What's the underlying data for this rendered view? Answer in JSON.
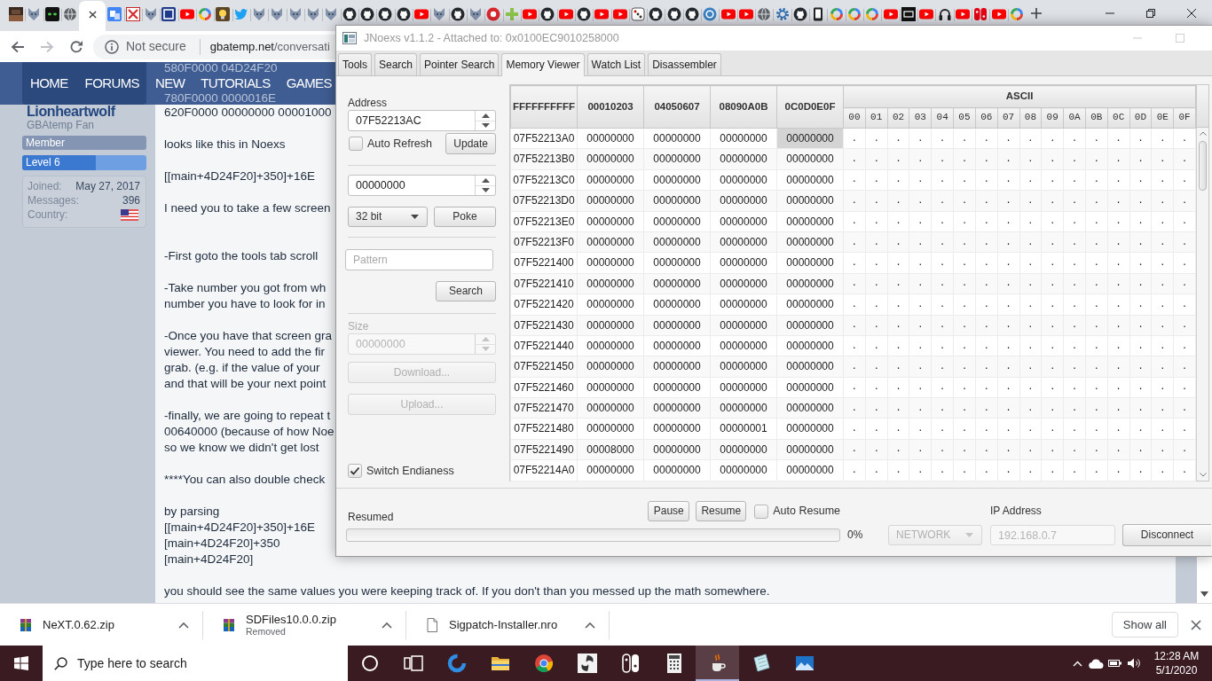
{
  "browser": {
    "tabs": [
      {
        "kind": "photo",
        "selected": false
      },
      {
        "kind": "wolf",
        "selected": false
      },
      {
        "kind": "eyes",
        "selected": false
      },
      {
        "kind": "globe",
        "selected": false
      },
      {
        "selected": true
      },
      {
        "kind": "translate",
        "selected": false
      },
      {
        "kind": "cross",
        "selected": false
      },
      {
        "kind": "wolf",
        "selected": false
      },
      {
        "kind": "square",
        "selected": false
      },
      {
        "kind": "play",
        "selected": false
      },
      {
        "kind": "ring",
        "selected": false
      },
      {
        "kind": "bulb",
        "selected": false
      },
      {
        "kind": "bird",
        "selected": false
      },
      {
        "kind": "wolf",
        "selected": false
      },
      {
        "kind": "wolf",
        "selected": false
      },
      {
        "kind": "wolf",
        "selected": false
      },
      {
        "kind": "wolf",
        "selected": false
      },
      {
        "kind": "wolf",
        "selected": false
      },
      {
        "kind": "cat",
        "selected": false
      },
      {
        "kind": "cat",
        "selected": false
      },
      {
        "kind": "cat",
        "selected": false
      },
      {
        "kind": "cat",
        "selected": false
      },
      {
        "kind": "play",
        "selected": false
      },
      {
        "kind": "wolf",
        "selected": false
      },
      {
        "kind": "cat",
        "selected": false
      },
      {
        "kind": "wolf",
        "selected": false
      },
      {
        "kind": "disc",
        "selected": false
      },
      {
        "kind": "plus",
        "selected": false
      },
      {
        "kind": "play",
        "selected": false
      },
      {
        "kind": "cat",
        "selected": false
      },
      {
        "kind": "play",
        "selected": false
      },
      {
        "kind": "cat",
        "selected": false
      },
      {
        "kind": "play",
        "selected": false
      },
      {
        "kind": "play",
        "selected": false
      },
      {
        "kind": "dice",
        "selected": false
      },
      {
        "kind": "cat",
        "selected": false
      },
      {
        "kind": "cat",
        "selected": false
      },
      {
        "kind": "cat",
        "selected": false
      },
      {
        "kind": "badge",
        "selected": false
      },
      {
        "kind": "play",
        "selected": false
      },
      {
        "kind": "play",
        "selected": false
      },
      {
        "kind": "globe",
        "selected": false
      },
      {
        "kind": "gear",
        "selected": false
      },
      {
        "kind": "cat",
        "selected": false
      },
      {
        "kind": "phone",
        "selected": false
      },
      {
        "kind": "ring",
        "selected": false
      },
      {
        "kind": "ring",
        "selected": false
      },
      {
        "kind": "ring",
        "selected": false
      },
      {
        "kind": "play",
        "selected": false
      },
      {
        "kind": "tile",
        "selected": false
      },
      {
        "kind": "play",
        "selected": false
      },
      {
        "kind": "headphones",
        "selected": false
      },
      {
        "kind": "play",
        "selected": false
      },
      {
        "kind": "controller",
        "selected": false
      },
      {
        "kind": "play",
        "selected": false
      },
      {
        "kind": "ring",
        "selected": false
      }
    ],
    "toolbar": {
      "security": "Not secure",
      "host": "gbatemp.net",
      "path": "/conversati"
    }
  },
  "page": {
    "nav": [
      "HOME",
      "FORUMS",
      "NEW",
      "TUTORIALS",
      "GAMES"
    ],
    "header_lines": [
      "580F0000 04D24F20",
      "780F0000 0000016E"
    ],
    "user": {
      "name": "Lionheartwolf",
      "title": "GBAtemp Fan",
      "badge": "Member",
      "level_label": "Level 6",
      "level": 0.59,
      "stats": [
        {
          "kind": "text",
          "label": "Joined:",
          "value": "May 27, 2017"
        },
        {
          "kind": "text",
          "label": "Messages:",
          "value": "396"
        },
        {
          "kind": "flag",
          "label": "Country:"
        }
      ]
    },
    "post": [
      {
        "kind": "plain",
        "lines": [
          "620F0000 00000000 00001000"
        ]
      },
      {
        "kind": "plain",
        "lines": [
          "looks like this in Noexs"
        ]
      },
      {
        "kind": "plain",
        "lines": [
          "[[main+4D24F20]+350]+16E"
        ]
      },
      {
        "kind": "spaced",
        "lines": [
          "I need you to take a few screen"
        ]
      },
      {
        "kind": "plain",
        "lines": [
          "-First goto the tools tab scroll"
        ]
      },
      {
        "kind": "plain",
        "lines": [
          "-Take number you got from wh",
          "number you have to look for in"
        ]
      },
      {
        "kind": "plain",
        "lines": [
          "-Once you have that screen gra",
          "viewer. You need to add the fir",
          "grab. (e.g. if the value of your",
          "and that will be your next point"
        ]
      },
      {
        "kind": "plain",
        "lines": [
          "-finally, we are going to repeat t",
          "00640000 (because of how Noe",
          "so we know we didn't get lost"
        ]
      },
      {
        "kind": "plain",
        "lines": [
          "****You can also double check"
        ]
      },
      {
        "kind": "plain",
        "lines": [
          "by parsing",
          "[[main+4D24F20]+350]+16E",
          "[main+4D24F20]+350",
          "[main+4D24F20]"
        ]
      },
      {
        "kind": "plain",
        "lines": [
          "you should see the same values you were keeping track of. If you don't than you messed up the math somewhere."
        ]
      }
    ]
  },
  "downloads": {
    "items": [
      {
        "kind": "archive",
        "name": "NeXT.0.62.zip"
      },
      {
        "kind": "archive",
        "name": "SDFiles10.0.0.zip",
        "status": "Removed"
      },
      {
        "kind": "file",
        "name": "Sigpatch-Installer.nro"
      }
    ],
    "show_all": "Show all"
  },
  "taskbar": {
    "search": {
      "placeholder": "Type here to search"
    },
    "apps": [
      {
        "kind": "circle",
        "selected": false
      },
      {
        "kind": "taskview",
        "selected": false
      },
      {
        "kind": "swirlblue",
        "selected": false
      },
      {
        "kind": "folder",
        "selected": false
      },
      {
        "kind": "ball",
        "selected": false
      },
      {
        "kind": "swirl",
        "selected": false
      },
      {
        "kind": "controller",
        "selected": false
      },
      {
        "kind": "calculator",
        "selected": false
      },
      {
        "kind": "cup",
        "selected": true
      },
      {
        "kind": "notepad",
        "selected": false
      },
      {
        "kind": "landscape",
        "selected": false
      }
    ],
    "time": "12:28 AM",
    "date": "5/1/2020"
  },
  "jnoexs": {
    "title": "JNoexs v1.1.2 - Attached to: 0x0100EC9010258000",
    "tabs": [
      {
        "label": "Tools",
        "selected": false
      },
      {
        "label": "Search",
        "selected": false
      },
      {
        "label": "Pointer Search",
        "selected": false
      },
      {
        "label": "Memory Viewer",
        "selected": true
      },
      {
        "label": "Watch List",
        "selected": false
      },
      {
        "label": "Disassembler",
        "selected": false
      }
    ],
    "viewer": {
      "address_label": "Address",
      "address": "07F52213AC",
      "auto_refresh": {
        "label": "Auto Refresh",
        "checked": false
      },
      "update": "Update",
      "poke_value": "00000000",
      "value_type": "32 bit",
      "poke": "Poke",
      "pattern": {
        "placeholder": "Pattern"
      },
      "search": "Search",
      "dump_size": {
        "label": "Size",
        "value": "00000000",
        "disabled": true
      },
      "download": {
        "label": "Download...",
        "disabled": true
      },
      "upload": {
        "label": "Upload...",
        "disabled": true
      },
      "switch_endianess": {
        "label": "Switch Endianess",
        "checked": true
      },
      "table": {
        "columns": [
          "FFFFFFFFFF",
          "00010203",
          "04050607",
          "08090A0B",
          "0C0D0E0F"
        ],
        "ascii_title": "ASCII",
        "ascii_columns": [
          "00",
          "01",
          "02",
          "03",
          "04",
          "05",
          "06",
          "07",
          "08",
          "09",
          "0A",
          "0B",
          "0C",
          "0D",
          "0E",
          "0F"
        ],
        "rows": [
          {
            "address": "07F52213A0",
            "words": [
              {
                "value": "00000000",
                "selected": false
              },
              {
                "value": "00000000",
                "selected": false
              },
              {
                "value": "00000000",
                "selected": false
              },
              {
                "value": "00000000",
                "selected": true
              }
            ],
            "ascii": [
              ".",
              ".",
              ".",
              ".",
              ".",
              ".",
              ".",
              ".",
              ".",
              ".",
              ".",
              ".",
              ".",
              ".",
              ".",
              "."
            ]
          },
          {
            "address": "07F52213B0",
            "words": [
              {
                "value": "00000000",
                "selected": false
              },
              {
                "value": "00000000",
                "selected": false
              },
              {
                "value": "00000000",
                "selected": false
              },
              {
                "value": "00000000",
                "selected": false
              }
            ],
            "ascii": [
              ".",
              ".",
              ".",
              ".",
              ".",
              ".",
              ".",
              ".",
              ".",
              ".",
              ".",
              ".",
              ".",
              ".",
              ".",
              "."
            ]
          },
          {
            "address": "07F52213C0",
            "words": [
              {
                "value": "00000000",
                "selected": false
              },
              {
                "value": "00000000",
                "selected": false
              },
              {
                "value": "00000000",
                "selected": false
              },
              {
                "value": "00000000",
                "selected": false
              }
            ],
            "ascii": [
              ".",
              ".",
              ".",
              ".",
              ".",
              ".",
              ".",
              ".",
              ".",
              ".",
              ".",
              ".",
              ".",
              ".",
              ".",
              "."
            ]
          },
          {
            "address": "07F52213D0",
            "words": [
              {
                "value": "00000000",
                "selected": false
              },
              {
                "value": "00000000",
                "selected": false
              },
              {
                "value": "00000000",
                "selected": false
              },
              {
                "value": "00000000",
                "selected": false
              }
            ],
            "ascii": [
              ".",
              ".",
              ".",
              ".",
              ".",
              ".",
              ".",
              ".",
              ".",
              ".",
              ".",
              ".",
              ".",
              ".",
              ".",
              "."
            ]
          },
          {
            "address": "07F52213E0",
            "words": [
              {
                "value": "00000000",
                "selected": false
              },
              {
                "value": "00000000",
                "selected": false
              },
              {
                "value": "00000000",
                "selected": false
              },
              {
                "value": "00000000",
                "selected": false
              }
            ],
            "ascii": [
              ".",
              ".",
              ".",
              ".",
              ".",
              ".",
              ".",
              ".",
              ".",
              ".",
              ".",
              ".",
              ".",
              ".",
              ".",
              "."
            ]
          },
          {
            "address": "07F52213F0",
            "words": [
              {
                "value": "00000000",
                "selected": false
              },
              {
                "value": "00000000",
                "selected": false
              },
              {
                "value": "00000000",
                "selected": false
              },
              {
                "value": "00000000",
                "selected": false
              }
            ],
            "ascii": [
              ".",
              ".",
              ".",
              ".",
              ".",
              ".",
              ".",
              ".",
              ".",
              ".",
              ".",
              ".",
              ".",
              ".",
              ".",
              "."
            ]
          },
          {
            "address": "07F5221400",
            "words": [
              {
                "value": "00000000",
                "selected": false
              },
              {
                "value": "00000000",
                "selected": false
              },
              {
                "value": "00000000",
                "selected": false
              },
              {
                "value": "00000000",
                "selected": false
              }
            ],
            "ascii": [
              ".",
              ".",
              ".",
              ".",
              ".",
              ".",
              ".",
              ".",
              ".",
              ".",
              ".",
              ".",
              ".",
              ".",
              ".",
              "."
            ]
          },
          {
            "address": "07F5221410",
            "words": [
              {
                "value": "00000000",
                "selected": false
              },
              {
                "value": "00000000",
                "selected": false
              },
              {
                "value": "00000000",
                "selected": false
              },
              {
                "value": "00000000",
                "selected": false
              }
            ],
            "ascii": [
              ".",
              ".",
              ".",
              ".",
              ".",
              ".",
              ".",
              ".",
              ".",
              ".",
              ".",
              ".",
              ".",
              ".",
              ".",
              "."
            ]
          },
          {
            "address": "07F5221420",
            "words": [
              {
                "value": "00000000",
                "selected": false
              },
              {
                "value": "00000000",
                "selected": false
              },
              {
                "value": "00000000",
                "selected": false
              },
              {
                "value": "00000000",
                "selected": false
              }
            ],
            "ascii": [
              ".",
              ".",
              ".",
              ".",
              ".",
              ".",
              ".",
              ".",
              ".",
              ".",
              ".",
              ".",
              ".",
              ".",
              ".",
              "."
            ]
          },
          {
            "address": "07F5221430",
            "words": [
              {
                "value": "00000000",
                "selected": false
              },
              {
                "value": "00000000",
                "selected": false
              },
              {
                "value": "00000000",
                "selected": false
              },
              {
                "value": "00000000",
                "selected": false
              }
            ],
            "ascii": [
              ".",
              ".",
              ".",
              ".",
              ".",
              ".",
              ".",
              ".",
              ".",
              ".",
              ".",
              ".",
              ".",
              ".",
              ".",
              "."
            ]
          },
          {
            "address": "07F5221440",
            "words": [
              {
                "value": "00000000",
                "selected": false
              },
              {
                "value": "00000000",
                "selected": false
              },
              {
                "value": "00000000",
                "selected": false
              },
              {
                "value": "00000000",
                "selected": false
              }
            ],
            "ascii": [
              ".",
              ".",
              ".",
              ".",
              ".",
              ".",
              ".",
              ".",
              ".",
              ".",
              ".",
              ".",
              ".",
              ".",
              ".",
              "."
            ]
          },
          {
            "address": "07F5221450",
            "words": [
              {
                "value": "00000000",
                "selected": false
              },
              {
                "value": "00000000",
                "selected": false
              },
              {
                "value": "00000000",
                "selected": false
              },
              {
                "value": "00000000",
                "selected": false
              }
            ],
            "ascii": [
              ".",
              ".",
              ".",
              ".",
              ".",
              ".",
              ".",
              ".",
              ".",
              ".",
              ".",
              ".",
              ".",
              ".",
              ".",
              "."
            ]
          },
          {
            "address": "07F5221460",
            "words": [
              {
                "value": "00000000",
                "selected": false
              },
              {
                "value": "00000000",
                "selected": false
              },
              {
                "value": "00000000",
                "selected": false
              },
              {
                "value": "00000000",
                "selected": false
              }
            ],
            "ascii": [
              ".",
              ".",
              ".",
              ".",
              ".",
              ".",
              ".",
              ".",
              ".",
              ".",
              ".",
              ".",
              ".",
              ".",
              ".",
              "."
            ]
          },
          {
            "address": "07F5221470",
            "words": [
              {
                "value": "00000000",
                "selected": false
              },
              {
                "value": "00000000",
                "selected": false
              },
              {
                "value": "00000000",
                "selected": false
              },
              {
                "value": "00000000",
                "selected": false
              }
            ],
            "ascii": [
              ".",
              ".",
              ".",
              ".",
              ".",
              ".",
              ".",
              ".",
              ".",
              ".",
              ".",
              ".",
              ".",
              ".",
              ".",
              "."
            ]
          },
          {
            "address": "07F5221480",
            "words": [
              {
                "value": "00000000",
                "selected": false
              },
              {
                "value": "00000000",
                "selected": false
              },
              {
                "value": "00000001",
                "selected": false
              },
              {
                "value": "00000000",
                "selected": false
              }
            ],
            "ascii": [
              ".",
              ".",
              ".",
              ".",
              ".",
              ".",
              ".",
              ".",
              ".",
              ".",
              ".",
              ".",
              ".",
              ".",
              ".",
              "."
            ]
          },
          {
            "address": "07F5221490",
            "words": [
              {
                "value": "00008000",
                "selected": false
              },
              {
                "value": "00000000",
                "selected": false
              },
              {
                "value": "00000000",
                "selected": false
              },
              {
                "value": "00000000",
                "selected": false
              }
            ],
            "ascii": [
              ".",
              ".",
              ".",
              ".",
              ".",
              ".",
              ".",
              ".",
              ".",
              ".",
              ".",
              ".",
              ".",
              ".",
              ".",
              "."
            ]
          },
          {
            "address": "07F52214A0",
            "words": [
              {
                "value": "00000000",
                "selected": false
              },
              {
                "value": "00000000",
                "selected": false
              },
              {
                "value": "00000000",
                "selected": false
              },
              {
                "value": "00000000",
                "selected": false
              }
            ],
            "ascii": [
              ".",
              ".",
              ".",
              ".",
              ".",
              ".",
              ".",
              ".",
              ".",
              ".",
              ".",
              ".",
              ".",
              ".",
              ".",
              "."
            ]
          }
        ]
      }
    },
    "status": {
      "text": "Resumed",
      "level": 0,
      "percent": "0%",
      "pause": "Pause",
      "resume": "Resume",
      "auto_resume": {
        "label": "Auto Resume",
        "checked": false
      },
      "connection": {
        "value": "NETWORK",
        "disabled": true
      },
      "ip_label": "IP Address",
      "ip": {
        "value": "192.168.0.7",
        "disabled": true
      },
      "disconnect": "Disconnect"
    }
  }
}
